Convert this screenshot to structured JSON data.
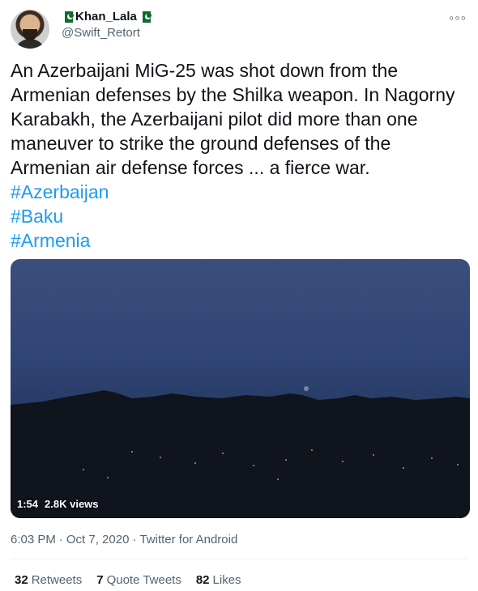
{
  "tweet": {
    "display_name": "Khan_Lala",
    "handle": "@Swift_Retort",
    "more_icon": "◦◦◦",
    "text_lines": [
      "An Azerbaijani MiG-25 was shot down from the Armenian defenses by the Shilka weapon.  In Nagorny Karabakh, the Azerbaijani pilot did more than one maneuver to strike the ground defenses of the Armenian air defense forces ... a fierce war."
    ],
    "hashtags": [
      "#Azerbaijan",
      "#Baku",
      "#Armenia"
    ],
    "video": {
      "duration": "1:54",
      "views": "2.8K views"
    },
    "meta": {
      "time": "6:03 PM",
      "separator1": "·",
      "date": "Oct 7, 2020",
      "separator2": "·",
      "source": "Twitter for Android"
    },
    "stats": {
      "retweets_count": "32",
      "retweets_label": "Retweets",
      "quote_count": "7",
      "quote_label": "Quote Tweets",
      "likes_count": "82",
      "likes_label": "Likes"
    }
  }
}
